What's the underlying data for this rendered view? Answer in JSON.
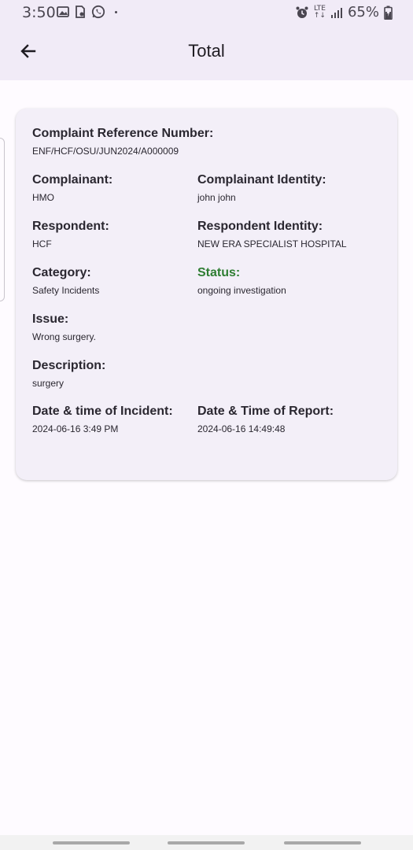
{
  "status_bar": {
    "time": "3:50",
    "network": "LTE",
    "battery": "65%"
  },
  "appbar": {
    "title": "Total",
    "back_icon": "arrow-left-icon"
  },
  "card": {
    "reference": {
      "label": "Complaint Reference Number:",
      "value": "ENF/HCF/OSU/JUN2024/A000009"
    },
    "complainant": {
      "label": "Complainant:",
      "value": "HMO"
    },
    "complainant_identity": {
      "label": "Complainant Identity:",
      "value": "john john"
    },
    "respondent": {
      "label": "Respondent:",
      "value": "HCF"
    },
    "respondent_identity": {
      "label": "Respondent Identity:",
      "value": "NEW ERA SPECIALIST HOSPITAL"
    },
    "category": {
      "label": "Category:",
      "value": "Safety Incidents"
    },
    "status": {
      "label": "Status:",
      "value": "ongoing investigation",
      "color": "#2e7d32"
    },
    "issue": {
      "label": "Issue:",
      "value": "Wrong surgery."
    },
    "description": {
      "label": "Description:",
      "value": "surgery"
    },
    "incident_datetime": {
      "label": "Date & time of Incident:",
      "value": "2024-06-16 3:49 PM"
    },
    "report_datetime": {
      "label": "Date & Time of Report:",
      "value": "2024-06-16 14:49:48"
    }
  }
}
